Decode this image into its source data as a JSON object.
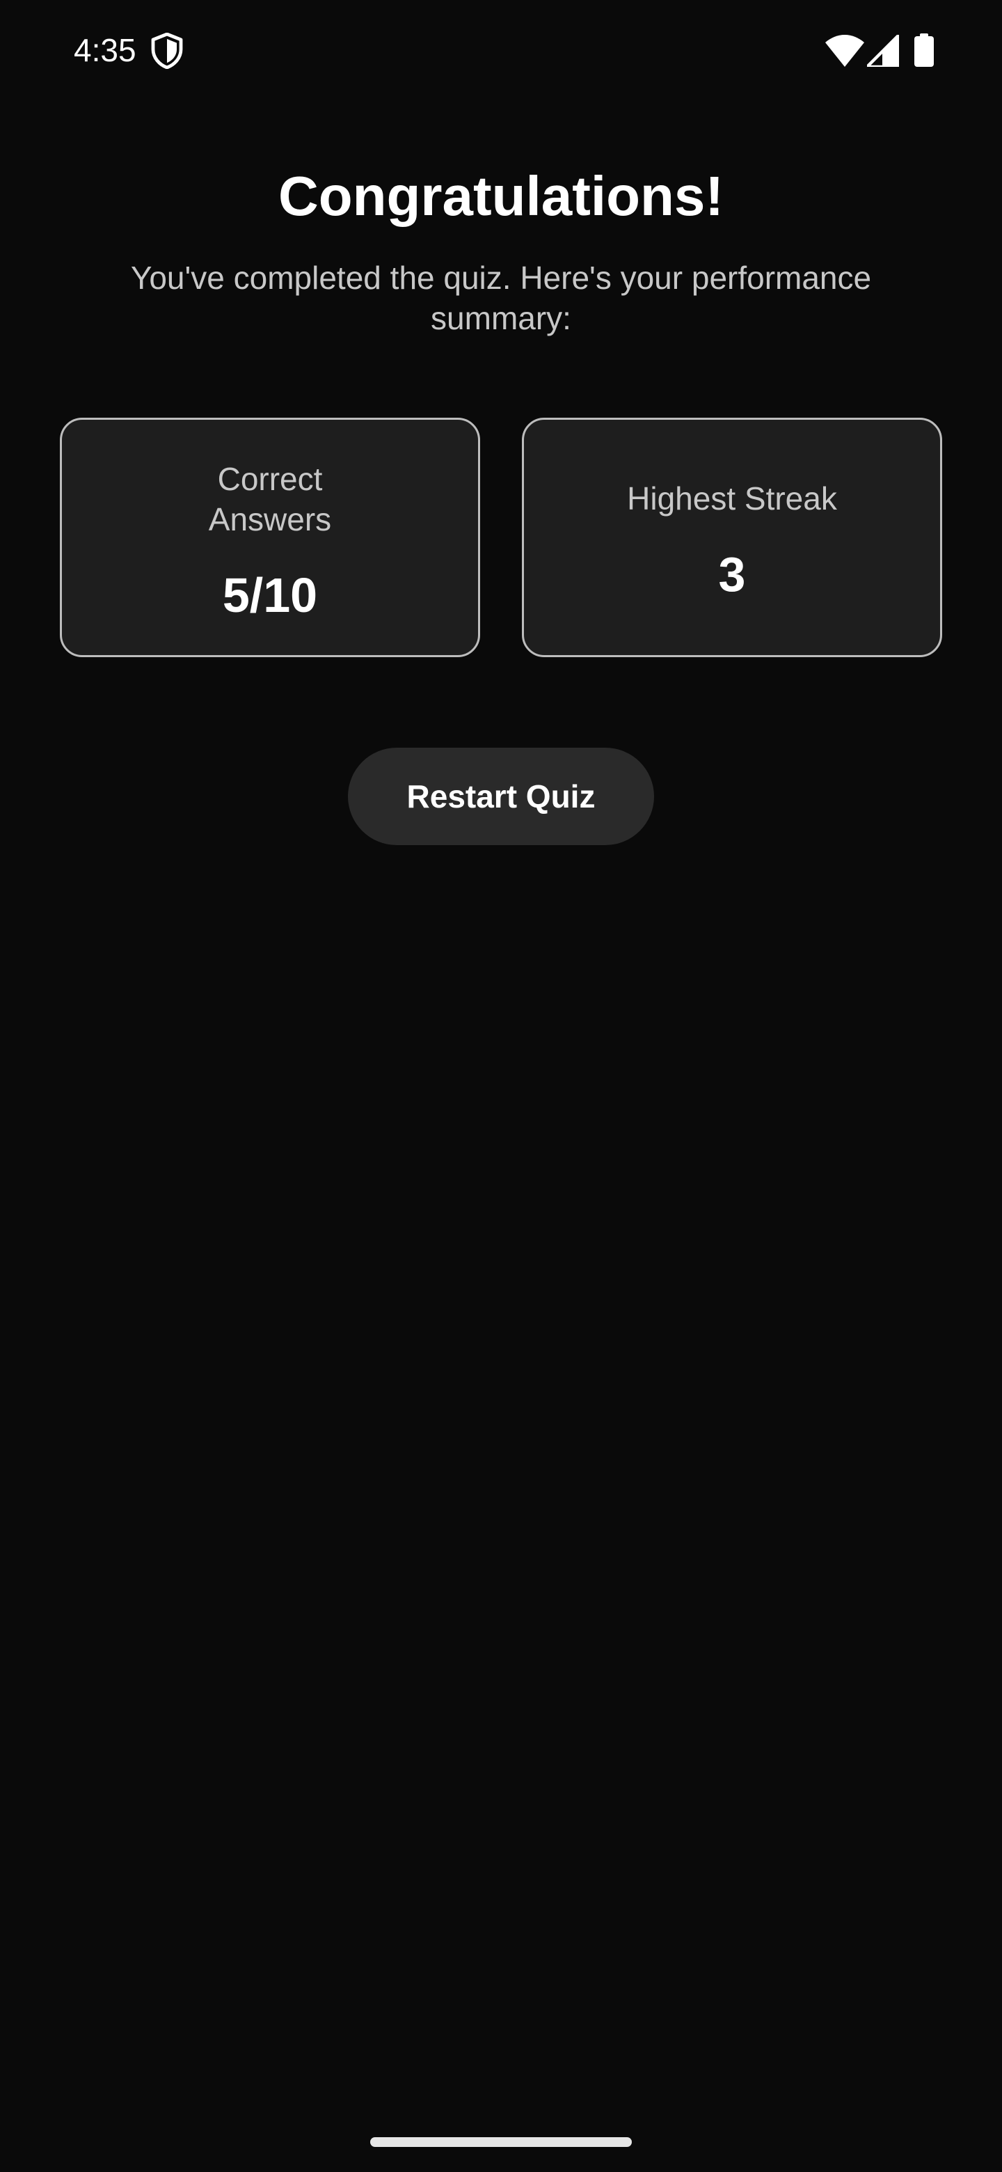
{
  "status_bar": {
    "time": "4:35",
    "icons": [
      "shield-icon",
      "wifi-icon",
      "signal-icon",
      "battery-icon"
    ]
  },
  "header": {
    "title": "Congratulations!",
    "subtitle": "You've completed the quiz. Here's your performance summary:"
  },
  "stats": [
    {
      "label": "Correct Answers",
      "value": "5/10"
    },
    {
      "label": "Highest Streak",
      "value": "3"
    }
  ],
  "actions": {
    "restart_label": "Restart Quiz"
  },
  "colors": {
    "background": "#0a0a0a",
    "card_background": "#1e1e1e",
    "card_border": "#bdbdbd",
    "button_background": "#2a2a2a",
    "text_primary": "#ffffff",
    "text_secondary": "#c8c8c8"
  }
}
